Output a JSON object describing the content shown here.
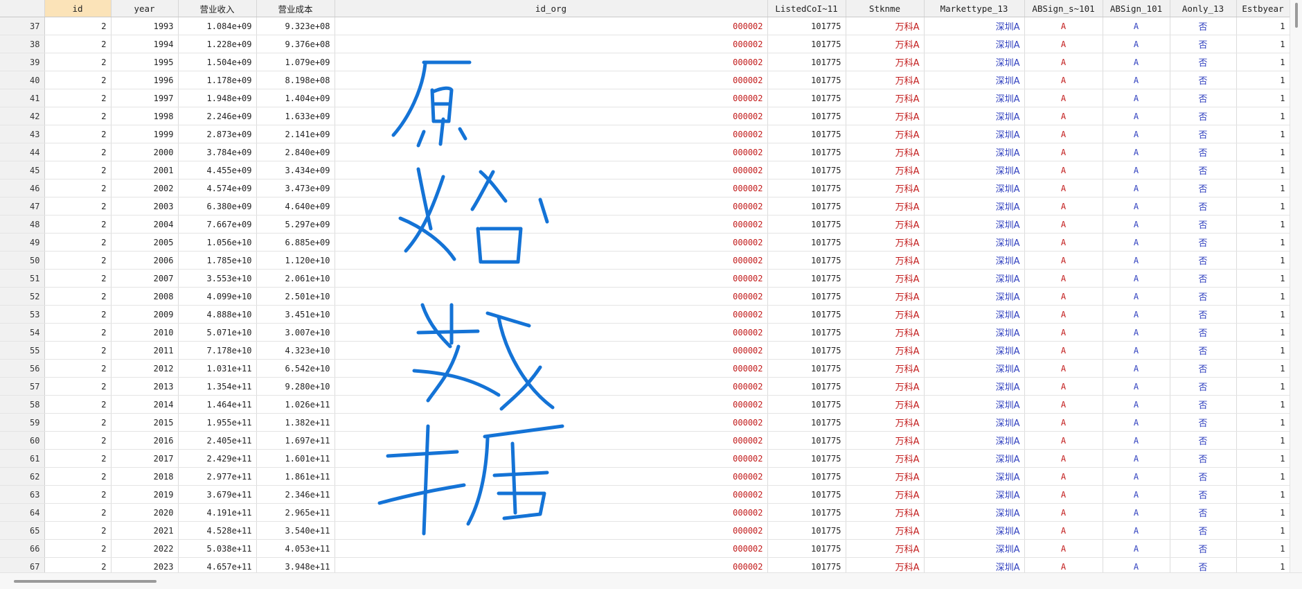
{
  "columns": [
    {
      "key": "rownum",
      "label": "",
      "cls": "rownum"
    },
    {
      "key": "id",
      "label": "id",
      "cls": "num"
    },
    {
      "key": "year",
      "label": "year",
      "cls": "num"
    },
    {
      "key": "revenue",
      "label": "营业收入",
      "cls": "num"
    },
    {
      "key": "cost",
      "label": "营业成本",
      "cls": "num"
    },
    {
      "key": "id_org",
      "label": "id_org",
      "cls": "str-red"
    },
    {
      "key": "listed",
      "label": "ListedCoI~11",
      "cls": "num"
    },
    {
      "key": "stknme",
      "label": "Stknme",
      "cls": "cjk-red"
    },
    {
      "key": "markettype",
      "label": "Markettype_13",
      "cls": "cjk-blue"
    },
    {
      "key": "absign_s",
      "label": "ABSign_s~101",
      "cls": "center-red"
    },
    {
      "key": "absign",
      "label": "ABSign_101",
      "cls": "center-blue"
    },
    {
      "key": "aonly",
      "label": "Aonly_13",
      "cls": "cjk-center-blue"
    },
    {
      "key": "estbyear",
      "label": "Estbyear",
      "cls": "num"
    }
  ],
  "selected_column": "id",
  "rows": [
    [
      "37",
      "2",
      "1993",
      "1.084e+09",
      "9.323e+08",
      "000002",
      "101775",
      "万科A",
      "深圳A",
      "A",
      "A",
      "否",
      "1"
    ],
    [
      "38",
      "2",
      "1994",
      "1.228e+09",
      "9.376e+08",
      "000002",
      "101775",
      "万科A",
      "深圳A",
      "A",
      "A",
      "否",
      "1"
    ],
    [
      "39",
      "2",
      "1995",
      "1.504e+09",
      "1.079e+09",
      "000002",
      "101775",
      "万科A",
      "深圳A",
      "A",
      "A",
      "否",
      "1"
    ],
    [
      "40",
      "2",
      "1996",
      "1.178e+09",
      "8.198e+08",
      "000002",
      "101775",
      "万科A",
      "深圳A",
      "A",
      "A",
      "否",
      "1"
    ],
    [
      "41",
      "2",
      "1997",
      "1.948e+09",
      "1.404e+09",
      "000002",
      "101775",
      "万科A",
      "深圳A",
      "A",
      "A",
      "否",
      "1"
    ],
    [
      "42",
      "2",
      "1998",
      "2.246e+09",
      "1.633e+09",
      "000002",
      "101775",
      "万科A",
      "深圳A",
      "A",
      "A",
      "否",
      "1"
    ],
    [
      "43",
      "2",
      "1999",
      "2.873e+09",
      "2.141e+09",
      "000002",
      "101775",
      "万科A",
      "深圳A",
      "A",
      "A",
      "否",
      "1"
    ],
    [
      "44",
      "2",
      "2000",
      "3.784e+09",
      "2.840e+09",
      "000002",
      "101775",
      "万科A",
      "深圳A",
      "A",
      "A",
      "否",
      "1"
    ],
    [
      "45",
      "2",
      "2001",
      "4.455e+09",
      "3.434e+09",
      "000002",
      "101775",
      "万科A",
      "深圳A",
      "A",
      "A",
      "否",
      "1"
    ],
    [
      "46",
      "2",
      "2002",
      "4.574e+09",
      "3.473e+09",
      "000002",
      "101775",
      "万科A",
      "深圳A",
      "A",
      "A",
      "否",
      "1"
    ],
    [
      "47",
      "2",
      "2003",
      "6.380e+09",
      "4.640e+09",
      "000002",
      "101775",
      "万科A",
      "深圳A",
      "A",
      "A",
      "否",
      "1"
    ],
    [
      "48",
      "2",
      "2004",
      "7.667e+09",
      "5.297e+09",
      "000002",
      "101775",
      "万科A",
      "深圳A",
      "A",
      "A",
      "否",
      "1"
    ],
    [
      "49",
      "2",
      "2005",
      "1.056e+10",
      "6.885e+09",
      "000002",
      "101775",
      "万科A",
      "深圳A",
      "A",
      "A",
      "否",
      "1"
    ],
    [
      "50",
      "2",
      "2006",
      "1.785e+10",
      "1.120e+10",
      "000002",
      "101775",
      "万科A",
      "深圳A",
      "A",
      "A",
      "否",
      "1"
    ],
    [
      "51",
      "2",
      "2007",
      "3.553e+10",
      "2.061e+10",
      "000002",
      "101775",
      "万科A",
      "深圳A",
      "A",
      "A",
      "否",
      "1"
    ],
    [
      "52",
      "2",
      "2008",
      "4.099e+10",
      "2.501e+10",
      "000002",
      "101775",
      "万科A",
      "深圳A",
      "A",
      "A",
      "否",
      "1"
    ],
    [
      "53",
      "2",
      "2009",
      "4.888e+10",
      "3.451e+10",
      "000002",
      "101775",
      "万科A",
      "深圳A",
      "A",
      "A",
      "否",
      "1"
    ],
    [
      "54",
      "2",
      "2010",
      "5.071e+10",
      "3.007e+10",
      "000002",
      "101775",
      "万科A",
      "深圳A",
      "A",
      "A",
      "否",
      "1"
    ],
    [
      "55",
      "2",
      "2011",
      "7.178e+10",
      "4.323e+10",
      "000002",
      "101775",
      "万科A",
      "深圳A",
      "A",
      "A",
      "否",
      "1"
    ],
    [
      "56",
      "2",
      "2012",
      "1.031e+11",
      "6.542e+10",
      "000002",
      "101775",
      "万科A",
      "深圳A",
      "A",
      "A",
      "否",
      "1"
    ],
    [
      "57",
      "2",
      "2013",
      "1.354e+11",
      "9.280e+10",
      "000002",
      "101775",
      "万科A",
      "深圳A",
      "A",
      "A",
      "否",
      "1"
    ],
    [
      "58",
      "2",
      "2014",
      "1.464e+11",
      "1.026e+11",
      "000002",
      "101775",
      "万科A",
      "深圳A",
      "A",
      "A",
      "否",
      "1"
    ],
    [
      "59",
      "2",
      "2015",
      "1.955e+11",
      "1.382e+11",
      "000002",
      "101775",
      "万科A",
      "深圳A",
      "A",
      "A",
      "否",
      "1"
    ],
    [
      "60",
      "2",
      "2016",
      "2.405e+11",
      "1.697e+11",
      "000002",
      "101775",
      "万科A",
      "深圳A",
      "A",
      "A",
      "否",
      "1"
    ],
    [
      "61",
      "2",
      "2017",
      "2.429e+11",
      "1.601e+11",
      "000002",
      "101775",
      "万科A",
      "深圳A",
      "A",
      "A",
      "否",
      "1"
    ],
    [
      "62",
      "2",
      "2018",
      "2.977e+11",
      "1.861e+11",
      "000002",
      "101775",
      "万科A",
      "深圳A",
      "A",
      "A",
      "否",
      "1"
    ],
    [
      "63",
      "2",
      "2019",
      "3.679e+11",
      "2.346e+11",
      "000002",
      "101775",
      "万科A",
      "深圳A",
      "A",
      "A",
      "否",
      "1"
    ],
    [
      "64",
      "2",
      "2020",
      "4.191e+11",
      "2.965e+11",
      "000002",
      "101775",
      "万科A",
      "深圳A",
      "A",
      "A",
      "否",
      "1"
    ],
    [
      "65",
      "2",
      "2021",
      "4.528e+11",
      "3.540e+11",
      "000002",
      "101775",
      "万科A",
      "深圳A",
      "A",
      "A",
      "否",
      "1"
    ],
    [
      "66",
      "2",
      "2022",
      "5.038e+11",
      "4.053e+11",
      "000002",
      "101775",
      "万科A",
      "深圳A",
      "A",
      "A",
      "否",
      "1"
    ],
    [
      "67",
      "2",
      "2023",
      "4.657e+11",
      "3.948e+11",
      "000002",
      "101775",
      "万科A",
      "深圳A",
      "A",
      "A",
      "否",
      "1"
    ]
  ],
  "annotation": {
    "text": "原始数据",
    "color": "#1473d6"
  }
}
